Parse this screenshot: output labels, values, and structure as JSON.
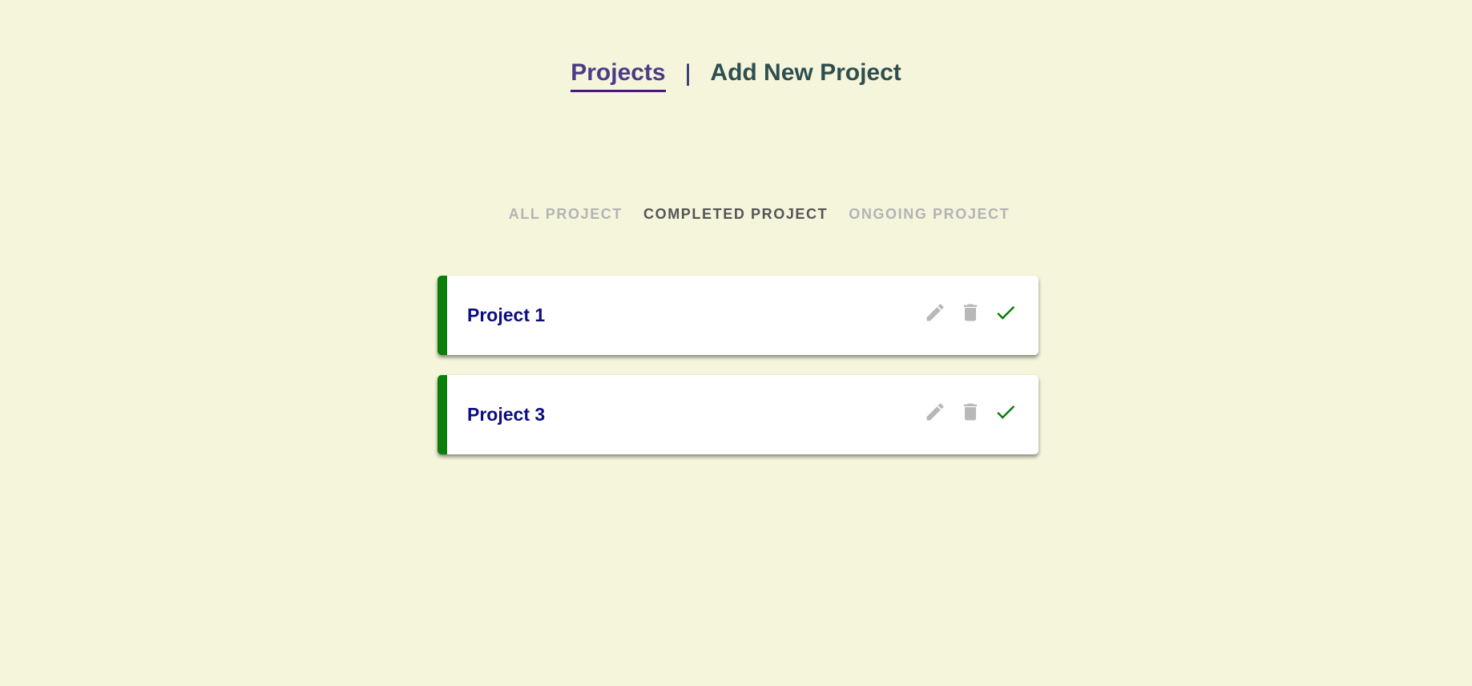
{
  "nav": {
    "projects_label": "Projects",
    "separator": "|",
    "add_new_label": "Add New Project"
  },
  "filters": {
    "all": "ALL PROJECT",
    "completed": "COMPLETED PROJECT",
    "ongoing": "ONGOING PROJECT",
    "selected": "completed"
  },
  "projects": [
    {
      "title": "Project 1",
      "status": "completed"
    },
    {
      "title": "Project 3",
      "status": "completed"
    }
  ],
  "icons": {
    "edit": "pencil-icon",
    "delete": "trash-icon",
    "complete": "check-icon"
  },
  "colors": {
    "background": "#f5f5dc",
    "nav_active": "#4b3c85",
    "nav_inactive": "#2f4f4f",
    "card_accent": "#0a7d0a",
    "project_title": "#0d0d80",
    "icon_muted": "#b8b8b8",
    "check": "#0a7d0a"
  }
}
